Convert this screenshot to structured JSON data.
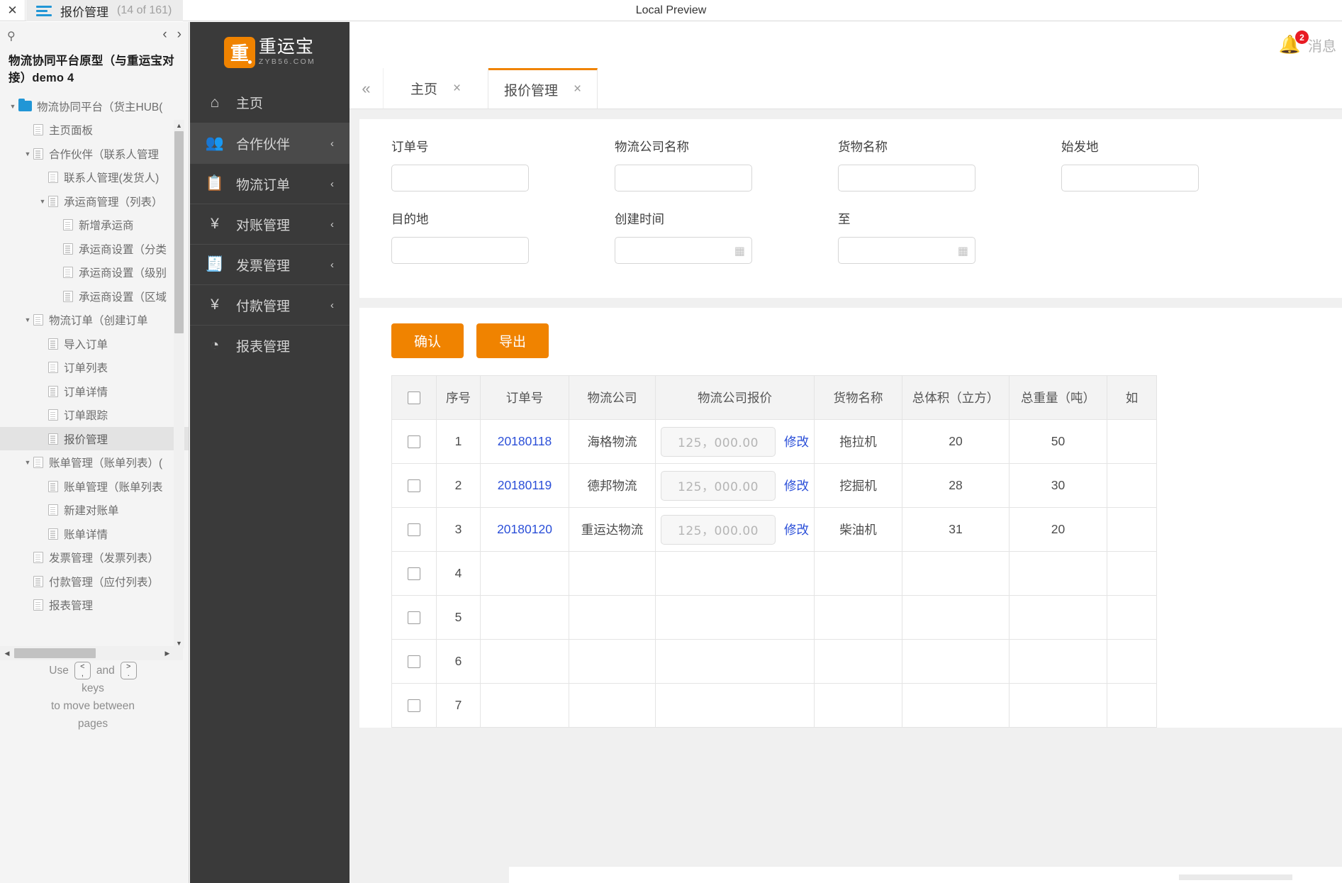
{
  "topbar": {
    "close_icon": "close-icon",
    "menu_icon": "hamburger-icon",
    "tab_title": "报价管理",
    "tab_count": "(14 of 161)",
    "center_title": "Local Preview"
  },
  "left_panel": {
    "search_icon": "search-icon",
    "prev_icon": "‹",
    "next_icon": "›",
    "title": "物流协同平台原型（与重运宝对接）demo 4",
    "tree": [
      {
        "label": "物流协同平台（货主HUB(",
        "depth": 0,
        "caret": "▼",
        "icon": "folder-icon",
        "selected": false
      },
      {
        "label": "主页面板",
        "depth": 1,
        "caret": "",
        "icon": "page-icon",
        "selected": false
      },
      {
        "label": "合作伙伴（联系人管理",
        "depth": 1,
        "caret": "▼",
        "icon": "page-icon",
        "selected": false
      },
      {
        "label": "联系人管理(发货人)",
        "depth": 2,
        "caret": "",
        "icon": "page-icon",
        "selected": false
      },
      {
        "label": "承运商管理（列表）",
        "depth": 2,
        "caret": "▼",
        "icon": "page-icon",
        "selected": false
      },
      {
        "label": "新增承运商",
        "depth": 3,
        "caret": "",
        "icon": "page-icon",
        "selected": false
      },
      {
        "label": "承运商设置（分类",
        "depth": 3,
        "caret": "",
        "icon": "page-icon",
        "selected": false
      },
      {
        "label": "承运商设置（级别",
        "depth": 3,
        "caret": "",
        "icon": "page-icon",
        "selected": false
      },
      {
        "label": "承运商设置（区域",
        "depth": 3,
        "caret": "",
        "icon": "page-icon",
        "selected": false
      },
      {
        "label": "物流订单（创建订单",
        "depth": 1,
        "caret": "▼",
        "icon": "page-icon",
        "selected": false
      },
      {
        "label": "导入订单",
        "depth": 2,
        "caret": "",
        "icon": "page-icon",
        "selected": false
      },
      {
        "label": "订单列表",
        "depth": 2,
        "caret": "",
        "icon": "page-icon",
        "selected": false
      },
      {
        "label": "订单详情",
        "depth": 2,
        "caret": "",
        "icon": "page-icon",
        "selected": false
      },
      {
        "label": "订单跟踪",
        "depth": 2,
        "caret": "",
        "icon": "page-icon",
        "selected": false
      },
      {
        "label": "报价管理",
        "depth": 2,
        "caret": "",
        "icon": "page-icon",
        "selected": true
      },
      {
        "label": "账单管理（账单列表）(",
        "depth": 1,
        "caret": "▼",
        "icon": "page-icon",
        "selected": false
      },
      {
        "label": "账单管理（账单列表",
        "depth": 2,
        "caret": "",
        "icon": "page-icon",
        "selected": false
      },
      {
        "label": "新建对账单",
        "depth": 2,
        "caret": "",
        "icon": "page-icon",
        "selected": false
      },
      {
        "label": "账单详情",
        "depth": 2,
        "caret": "",
        "icon": "page-icon",
        "selected": false
      },
      {
        "label": "发票管理（发票列表）",
        "depth": 1,
        "caret": "",
        "icon": "page-icon",
        "selected": false
      },
      {
        "label": "付款管理（应付列表）",
        "depth": 1,
        "caret": "",
        "icon": "page-icon",
        "selected": false
      },
      {
        "label": "报表管理",
        "depth": 1,
        "caret": "",
        "icon": "page-icon",
        "selected": false
      }
    ],
    "hint": {
      "use": "Use",
      "and": "and",
      "key_prev_top": "<",
      "key_prev_bottom": ",",
      "key_next_top": ">",
      "key_next_bottom": ".",
      "line2": "keys",
      "line3": "to move between",
      "line4": "pages"
    }
  },
  "nav": {
    "logo_mark": "重",
    "logo_cn": "重运宝",
    "logo_en": "ZYB56.COM",
    "items": [
      {
        "label": "主页",
        "icon": "home-icon",
        "glyph": "⌂",
        "chevron": "",
        "active": false
      },
      {
        "label": "合作伙伴",
        "icon": "users-icon",
        "glyph": "👥",
        "chevron": "‹",
        "active": true
      },
      {
        "label": "物流订单",
        "icon": "clipboard-icon",
        "glyph": "📋",
        "chevron": "‹",
        "active": false
      },
      {
        "label": "对账管理",
        "icon": "yen-note-icon",
        "glyph": "¥",
        "chevron": "‹",
        "active": false
      },
      {
        "label": "发票管理",
        "icon": "invoice-icon",
        "glyph": "🧾",
        "chevron": "‹",
        "active": false
      },
      {
        "label": "付款管理",
        "icon": "shield-yen-icon",
        "glyph": "¥",
        "chevron": "‹",
        "active": false
      },
      {
        "label": "报表管理",
        "icon": "pie-chart-icon",
        "glyph": "◔",
        "chevron": "",
        "active": false
      }
    ]
  },
  "header": {
    "bell_icon": "bell-icon",
    "badge_count": "2",
    "message_label": "消息"
  },
  "tabs": {
    "collapse_icon": "collapse-left-icon",
    "items": [
      {
        "label": "主页",
        "close": "×",
        "active": false
      },
      {
        "label": "报价管理",
        "close": "×",
        "active": true
      }
    ]
  },
  "filters": [
    {
      "label": "订单号",
      "value": "",
      "placeholder": "",
      "type": "text"
    },
    {
      "label": "物流公司名称",
      "value": "",
      "placeholder": "",
      "type": "text"
    },
    {
      "label": "货物名称",
      "value": "",
      "placeholder": "",
      "type": "text"
    },
    {
      "label": "始发地",
      "value": "",
      "placeholder": "",
      "type": "text"
    },
    {
      "label": "目的地",
      "value": "",
      "placeholder": "",
      "type": "text"
    },
    {
      "label": "创建时间",
      "value": "",
      "placeholder": "",
      "type": "date"
    },
    {
      "label": "至",
      "value": "",
      "placeholder": "",
      "type": "date"
    }
  ],
  "actions": {
    "confirm_label": "确认",
    "export_label": "导出"
  },
  "table": {
    "select_all_icon": "checkbox-icon",
    "columns": [
      "",
      "序号",
      "订单号",
      "物流公司",
      "物流公司报价",
      "货物名称",
      "总体积（立方）",
      "总重量（吨）",
      "如"
    ],
    "edit_label": "修改",
    "price_placeholder": "125，000.00",
    "rows": [
      {
        "no": "1",
        "order_no": "20180118",
        "company": "海格物流",
        "price": "125，000.00",
        "cargo": "拖拉机",
        "volume": "20",
        "weight": "50",
        "extra": ""
      },
      {
        "no": "2",
        "order_no": "20180119",
        "company": "德邦物流",
        "price": "125，000.00",
        "cargo": "挖掘机",
        "volume": "28",
        "weight": "30",
        "extra": ""
      },
      {
        "no": "3",
        "order_no": "20180120",
        "company": "重运达物流",
        "price": "125，000.00",
        "cargo": "柴油机",
        "volume": "31",
        "weight": "20",
        "extra": ""
      },
      {
        "no": "4",
        "order_no": "",
        "company": "",
        "price": "",
        "cargo": "",
        "volume": "",
        "weight": "",
        "extra": ""
      },
      {
        "no": "5",
        "order_no": "",
        "company": "",
        "price": "",
        "cargo": "",
        "volume": "",
        "weight": "",
        "extra": ""
      },
      {
        "no": "6",
        "order_no": "",
        "company": "",
        "price": "",
        "cargo": "",
        "volume": "",
        "weight": "",
        "extra": ""
      },
      {
        "no": "7",
        "order_no": "",
        "company": "",
        "price": "",
        "cargo": "",
        "volume": "",
        "weight": "",
        "extra": ""
      }
    ]
  },
  "colors": {
    "accent": "#f08300",
    "link": "#2b4fd8",
    "nav_bg": "#3a3a3a",
    "badge": "#e81b23"
  }
}
